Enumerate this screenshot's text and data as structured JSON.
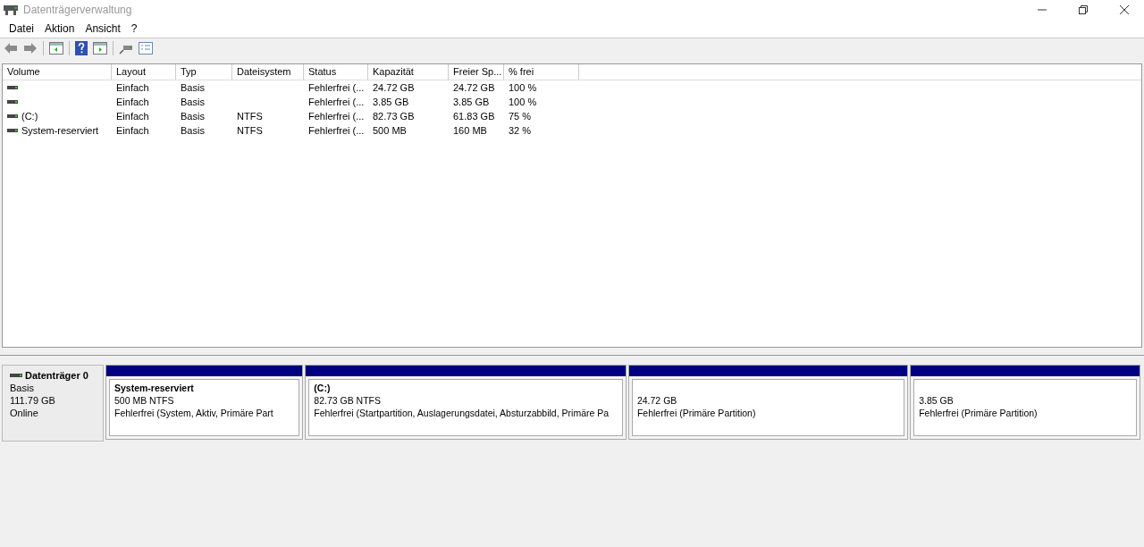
{
  "window": {
    "title": "Datenträgerverwaltung"
  },
  "menu": [
    "Datei",
    "Aktion",
    "Ansicht",
    "?"
  ],
  "table": {
    "columns": [
      "Volume",
      "Layout",
      "Typ",
      "Dateisystem",
      "Status",
      "Kapazität",
      "Freier Sp...",
      "% frei"
    ],
    "rows": [
      {
        "cells": [
          "",
          "Einfach",
          "Basis",
          "",
          "Fehlerfrei (...",
          "24.72 GB",
          "24.72 GB",
          "100 %"
        ]
      },
      {
        "cells": [
          "",
          "Einfach",
          "Basis",
          "",
          "Fehlerfrei (...",
          "3.85 GB",
          "3.85 GB",
          "100 %"
        ]
      },
      {
        "cells": [
          "(C:)",
          "Einfach",
          "Basis",
          "NTFS",
          "Fehlerfrei (...",
          "82.73 GB",
          "61.83 GB",
          "75 %"
        ]
      },
      {
        "cells": [
          "System-reserviert",
          "Einfach",
          "Basis",
          "NTFS",
          "Fehlerfrei (...",
          "500 MB",
          "160 MB",
          "32 %"
        ]
      }
    ]
  },
  "disks": [
    {
      "name": "Datenträger 0",
      "type": "Basis",
      "size": "111.79 GB",
      "state": "Online",
      "partitions": [
        {
          "name": "System-reserviert",
          "size": "500 MB NTFS",
          "status": "Fehlerfrei (System, Aktiv, Primäre Part"
        },
        {
          "name": "(C:)",
          "size": "82.73 GB NTFS",
          "status": "Fehlerfrei (Startpartition, Auslagerungsdatei, Absturzabbild, Primäre Pa"
        },
        {
          "size": "24.72 GB",
          "status": "Fehlerfrei (Primäre Partition)"
        },
        {
          "size": "3.85 GB",
          "status": "Fehlerfrei (Primäre Partition)"
        }
      ]
    }
  ]
}
